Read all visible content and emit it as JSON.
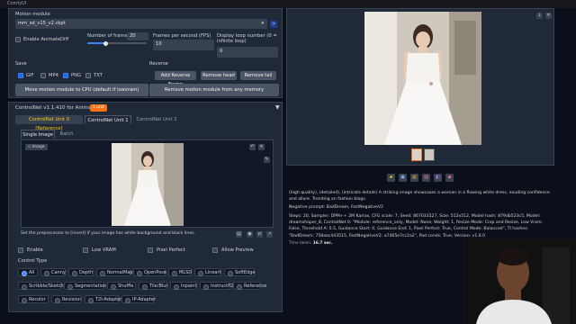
{
  "window": {
    "title": "ComfyUI"
  },
  "animatediff": {
    "motion_module_label": "Motion module",
    "motion_module_value": "mm_sd_v15_v2.ckpt",
    "enable_label": "Enable AnimateDiff",
    "frames_label": "Number of frames",
    "frames_value": "20",
    "fps_label": "Frames per second (FPS)",
    "fps_value": "10",
    "loop_label": "Display loop number (0 = infinite loop)",
    "loop_value": "0",
    "save_label": "Save",
    "save_options": [
      {
        "label": "GIF",
        "checked": true
      },
      {
        "label": "MP4",
        "checked": false
      },
      {
        "label": "PNG",
        "checked": true
      },
      {
        "label": "TXT",
        "checked": false
      }
    ],
    "reverse_label": "Reverse",
    "reverse_buttons": [
      "Add Reverse Frame",
      "Remove head",
      "Remove tail"
    ],
    "move_cpu_button": "Move motion module to CPU (default if lowvram)",
    "remove_motion_button": "Remove motion module from any memory"
  },
  "controlnet": {
    "title": "ControlNet v1.1.410 for AnimateDiff",
    "badge": "1 unit",
    "unit_tabs": [
      "ControlNet Unit 0 [Reference]",
      "ControlNet Unit 1",
      "ControlNet Unit 2"
    ],
    "image_tabs": [
      "Single Image",
      "Batch"
    ],
    "image_badge": "Image",
    "preprocessor_hint": "Set the preprocessor to [invert] if your image has white background and black lines.",
    "options": [
      "Enable",
      "Low VRAM",
      "Pixel Perfect",
      "Allow Preview"
    ],
    "control_type_label": "Control Type",
    "control_types_row1": [
      "All",
      "Canny",
      "Depth",
      "NormalMap",
      "OpenPose",
      "MLSD",
      "Lineart",
      "SoftEdge"
    ],
    "control_types_row2": [
      "Scribble/Sketch",
      "Segmentation",
      "Shuffle",
      "Tile/Blur",
      "Inpaint",
      "InstructP2P",
      "Reference"
    ],
    "control_types_row3": [
      "Recolor",
      "Revision",
      "T2I-Adapter",
      "IP-Adapter"
    ]
  },
  "output": {
    "prompt": "(high quality), (detailed), (intricate details) A striking image showcases a woman in a flowing white dress, exuding confidence and allure. Trending on fashion blogs.",
    "negative": "Negative prompt: BadDream, FastNegativeV2",
    "params": "Steps: 20, Sampler: DPM++ 2M Karras, CFG scale: 7, Seed: 867033527, Size: 512x512, Model hash: 879db523c5, Model: dreamshaper_8, ControlNet 0: \"Module: reference_only, Model: None, Weight: 1, Resize Mode: Crop and Resize, Low Vram: False, Threshold A: 0.5, Guidance Start: 0, Guidance End: 1, Pixel Perfect: True, Control Mode: Balanced\", TI hashes: \"BadDream: 758aac443515, FastNegativeV2: a7465e7cc2a2\", Pad conds: True, Version: v1.6.0",
    "time_taken_label": "Time taken:",
    "time_taken_value": "16.7 sec."
  },
  "colors": {
    "accent": "#3b82f6",
    "orange": "#f97316",
    "panel": "#1f2937",
    "bg": "#0b0f19"
  }
}
